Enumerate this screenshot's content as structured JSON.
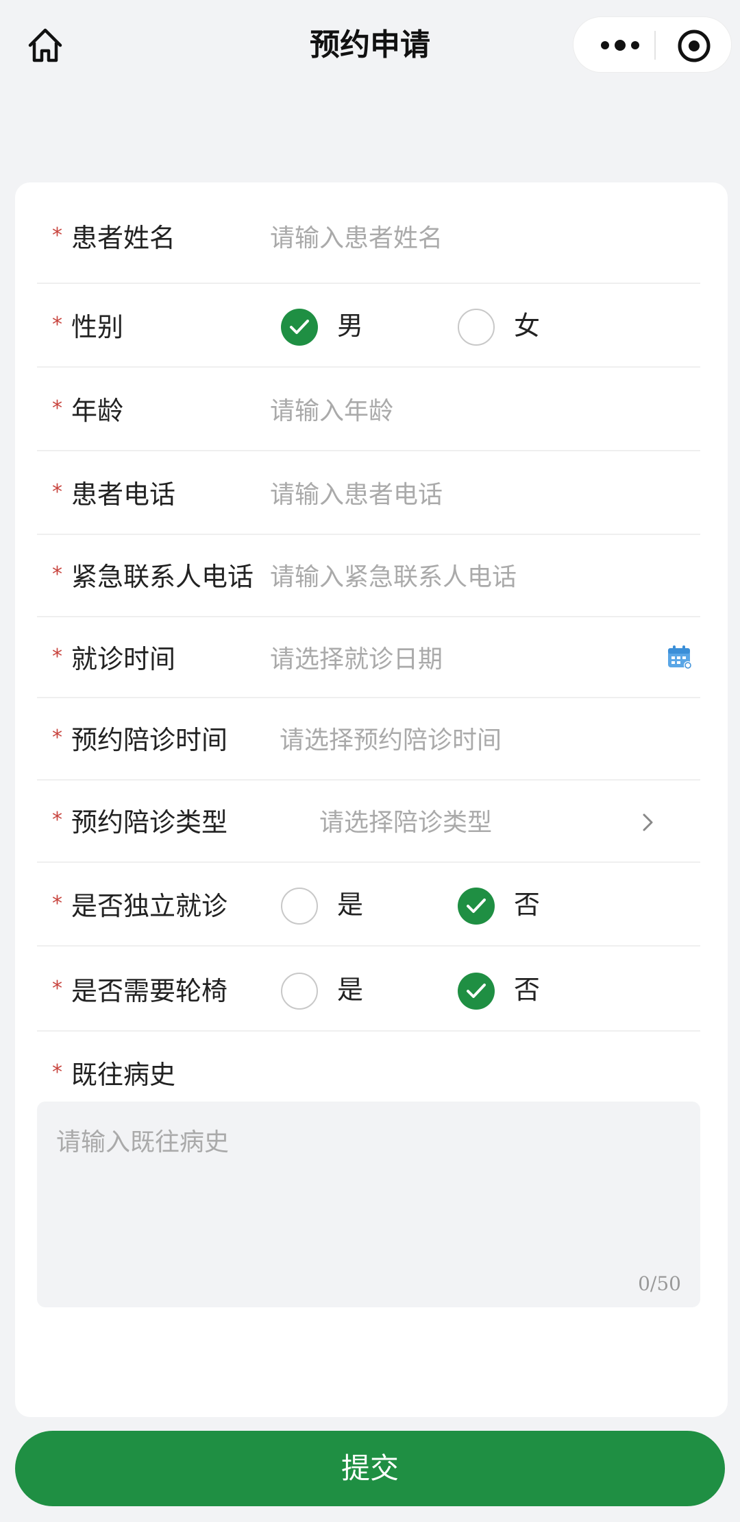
{
  "nav": {
    "title": "预约申请",
    "home_icon": "home-icon",
    "more_icon": "more-dots-icon",
    "target_icon": "target-icon"
  },
  "colors": {
    "accent": "#1f8f43",
    "required": "#c8453f",
    "placeholder": "#aaaaaa"
  },
  "form": {
    "patient_name": {
      "required_mark": "*",
      "label": "患者姓名",
      "placeholder": "请输入患者姓名"
    },
    "gender": {
      "required_mark": "*",
      "label": "性别",
      "options": [
        "男",
        "女"
      ],
      "selected": "男"
    },
    "age": {
      "required_mark": "*",
      "label": "年龄",
      "placeholder": "请输入年龄"
    },
    "patient_phone": {
      "required_mark": "*",
      "label": "患者电话",
      "placeholder": "请输入患者电话"
    },
    "emergency_phone": {
      "required_mark": "*",
      "label": "紧急联系人电话",
      "placeholder": "请输入紧急联系人电话"
    },
    "visit_time": {
      "required_mark": "*",
      "label": "就诊时间",
      "placeholder": "请选择就诊日期",
      "icon": "calendar-icon"
    },
    "escort_time": {
      "required_mark": "*",
      "label": "预约陪诊时间",
      "placeholder": "请选择预约陪诊时间"
    },
    "escort_type": {
      "required_mark": "*",
      "label": "预约陪诊类型",
      "placeholder": "请选择陪诊类型",
      "icon": "chevron-right-icon"
    },
    "independent": {
      "required_mark": "*",
      "label": "是否独立就诊",
      "options": [
        "是",
        "否"
      ],
      "selected": "否"
    },
    "wheelchair": {
      "required_mark": "*",
      "label": "是否需要轮椅",
      "options": [
        "是",
        "否"
      ],
      "selected": "否"
    },
    "history": {
      "required_mark": "*",
      "label": "既往病史",
      "placeholder": "请输入既往病史",
      "counter": "0/50"
    }
  },
  "submit_label": "提交"
}
